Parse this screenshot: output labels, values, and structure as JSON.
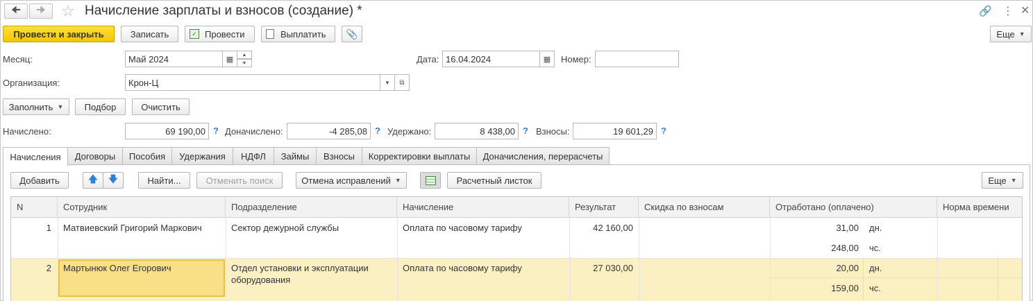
{
  "window": {
    "title": "Начисление зарплаты и взносов (создание) *"
  },
  "toolbar": {
    "post_close": "Провести и закрыть",
    "save": "Записать",
    "post": "Провести",
    "pay": "Выплатить",
    "more": "Еще"
  },
  "header": {
    "month_label": "Месяц:",
    "month_value": "Май 2024",
    "date_label": "Дата:",
    "date_value": "16.04.2024",
    "number_label": "Номер:",
    "number_value": "",
    "org_label": "Организация:",
    "org_value": "Крон-Ц"
  },
  "actions": {
    "fill": "Заполнить",
    "pick": "Подбор",
    "clear": "Очистить"
  },
  "totals": {
    "accrued_label": "Начислено:",
    "accrued_value": "69 190,00",
    "additional_label": "Доначислено:",
    "additional_value": "-4 285,08",
    "withheld_label": "Удержано:",
    "withheld_value": "8 438,00",
    "contrib_label": "Взносы:",
    "contrib_value": "19 601,29",
    "help": "?"
  },
  "tabs": [
    "Начисления",
    "Договоры",
    "Пособия",
    "Удержания",
    "НДФЛ",
    "Займы",
    "Взносы",
    "Корректировки выплаты",
    "Доначисления, перерасчеты"
  ],
  "grid_toolbar": {
    "add": "Добавить",
    "find": "Найти...",
    "cancel_search": "Отменить поиск",
    "cancel_fixes": "Отмена исправлений",
    "payslip": "Расчетный листок",
    "more": "Еще"
  },
  "columns": [
    "N",
    "Сотрудник",
    "Подразделение",
    "Начисление",
    "Результат",
    "Скидка по взносам",
    "Отработано (оплачено)",
    "Норма времени"
  ],
  "rows": [
    {
      "n": "1",
      "employee": "Матвиевский Григорий Маркович",
      "department": "Сектор дежурной службы",
      "accrual": "Оплата по часовому тарифу",
      "result": "42 160,00",
      "worked_days": "31,00",
      "days_unit": "дн.",
      "worked_hours": "248,00",
      "hours_unit": "чс."
    },
    {
      "n": "2",
      "employee": "Мартынюк Олег Егорович",
      "department_line1": "Отдел установки и эксплуатации",
      "department_line2": "оборудования",
      "accrual": "Оплата по часовому тарифу",
      "result": "27 030,00",
      "worked_days": "20,00",
      "days_unit": "дн.",
      "worked_hours": "159,00",
      "hours_unit": "чс."
    }
  ],
  "colors": {
    "primary_button": "#f5cc00",
    "selected_row": "#fbf0c2",
    "selected_cell": "#f9df85"
  }
}
